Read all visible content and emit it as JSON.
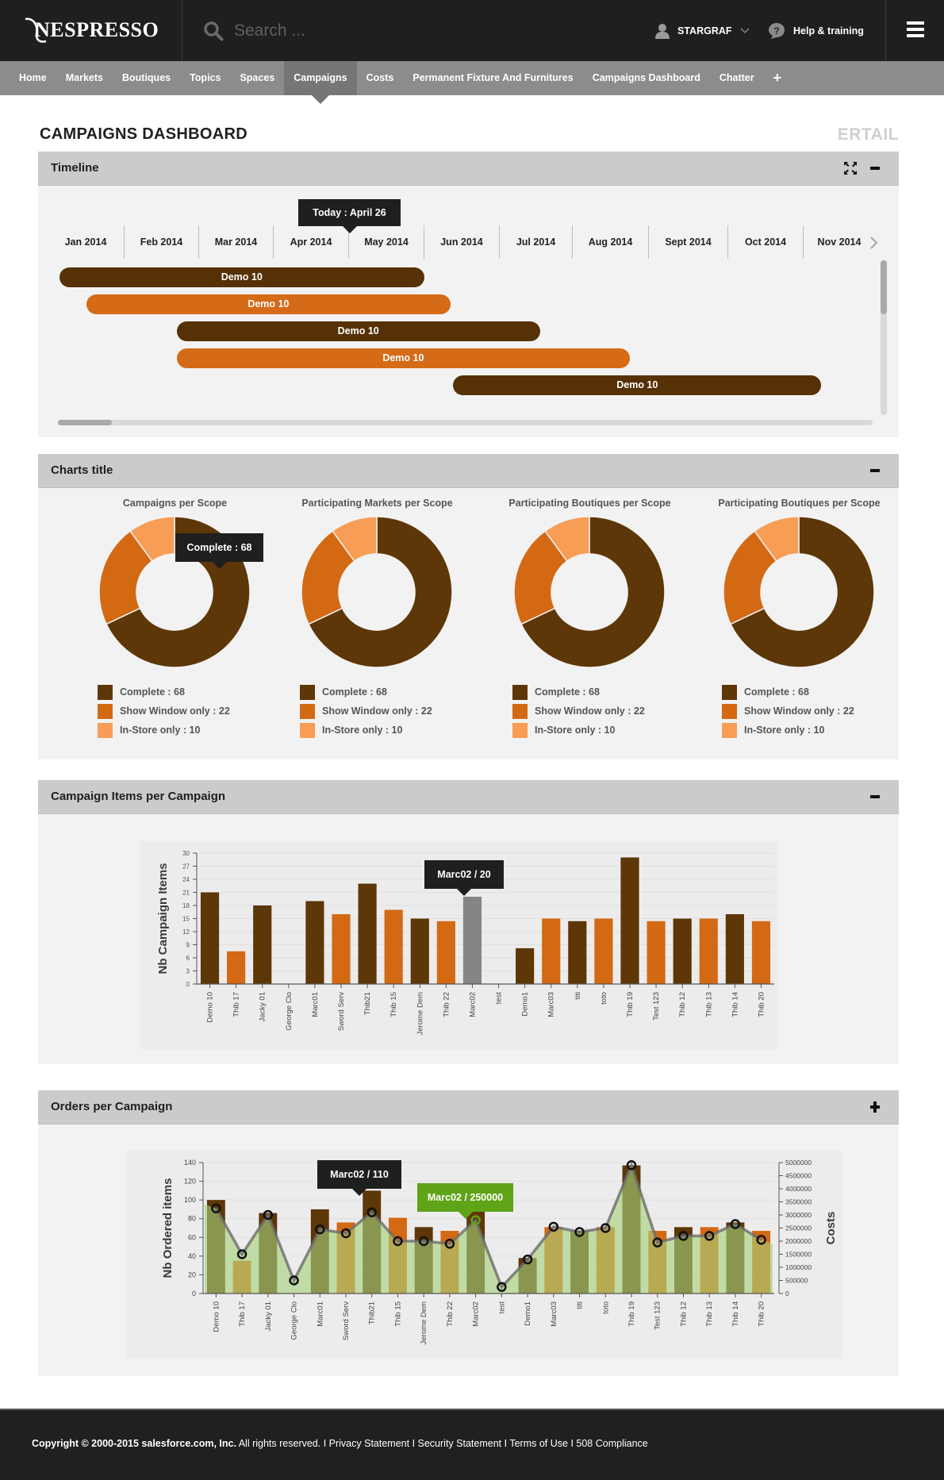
{
  "header": {
    "logo_text": "NESPRESSO",
    "search_placeholder": "Search ...",
    "user_name": "STARGRAF",
    "help_label": "Help & training"
  },
  "nav": {
    "items": [
      {
        "label": "Home",
        "active": false
      },
      {
        "label": "Markets",
        "active": false
      },
      {
        "label": "Boutiques",
        "active": false
      },
      {
        "label": "Topics",
        "active": false
      },
      {
        "label": "Spaces",
        "active": false
      },
      {
        "label": "Campaigns",
        "active": true
      },
      {
        "label": "Costs",
        "active": false
      },
      {
        "label": "Permanent Fixture And Furnitures",
        "active": false
      },
      {
        "label": "Campaigns Dashboard",
        "active": false
      },
      {
        "label": "Chatter",
        "active": false
      }
    ],
    "add_label": "+"
  },
  "page": {
    "title": "CAMPAIGNS DASHBOARD",
    "brand_right": "ERTAIL"
  },
  "timeline": {
    "title": "Timeline",
    "today_label": "Today : April 26",
    "months": [
      "Jan 2014",
      "Feb 2014",
      "Mar 2014",
      "Apr 2014",
      "May 2014",
      "Jun 2014",
      "Jul 2014",
      "Aug 2014",
      "Sept 2014",
      "Oct 2014",
      "Nov 2014"
    ],
    "bars": [
      {
        "label": "Demo 10",
        "color": "#563106",
        "start_month": 0.15,
        "end_month": 5.0
      },
      {
        "label": "Demo 10",
        "color": "#d56a17",
        "start_month": 0.5,
        "end_month": 5.35
      },
      {
        "label": "Demo 10",
        "color": "#563106",
        "start_month": 1.7,
        "end_month": 6.55
      },
      {
        "label": "Demo 10",
        "color": "#d56a17",
        "start_month": 1.7,
        "end_month": 7.75
      },
      {
        "label": "Demo 10",
        "color": "#563106",
        "start_month": 5.38,
        "end_month": 10.25
      }
    ]
  },
  "charts_panel": {
    "title": "Charts title",
    "tooltip": "Complete : 68",
    "donuts": [
      {
        "title": "Campaigns per Scope"
      },
      {
        "title": "Participating Markets per Scope"
      },
      {
        "title": "Participating Boutiques per Scope"
      },
      {
        "title": "Participating Boutiques per Scope"
      }
    ],
    "legend": [
      {
        "label": "Complete : 68",
        "color": "#5e3708"
      },
      {
        "label": "Show Window only : 22",
        "color": "#d46914"
      },
      {
        "label": "In-Store  only : 10",
        "color": "#f79d55"
      }
    ]
  },
  "items_panel": {
    "title": "Campaign Items per Campaign",
    "tooltip": "Marc02 / 20"
  },
  "orders_panel": {
    "title": "Orders per Campaign",
    "tooltip_items": "Marc02 / 110",
    "tooltip_costs": "Marc02 / 250000"
  },
  "chart_data": [
    {
      "type": "pie",
      "title": "Campaigns per Scope",
      "labels": [
        "Complete",
        "Show Window only",
        "In-Store  only"
      ],
      "values": [
        68,
        22,
        10
      ],
      "colors": [
        "#5e3708",
        "#d46914",
        "#f79d55"
      ],
      "donut": true
    },
    {
      "type": "pie",
      "title": "Participating Markets per Scope",
      "labels": [
        "Complete",
        "Show Window only",
        "In-Store  only"
      ],
      "values": [
        68,
        22,
        10
      ],
      "colors": [
        "#5e3708",
        "#d46914",
        "#f79d55"
      ],
      "donut": true
    },
    {
      "type": "pie",
      "title": "Participating Boutiques per Scope",
      "labels": [
        "Complete",
        "Show Window only",
        "In-Store  only"
      ],
      "values": [
        68,
        22,
        10
      ],
      "colors": [
        "#5e3708",
        "#d46914",
        "#f79d55"
      ],
      "donut": true
    },
    {
      "type": "pie",
      "title": "Participating Boutiques per Scope",
      "labels": [
        "Complete",
        "Show Window only",
        "In-Store  only"
      ],
      "values": [
        68,
        22,
        10
      ],
      "colors": [
        "#5e3708",
        "#d46914",
        "#f79d55"
      ],
      "donut": true
    },
    {
      "type": "bar",
      "title": "Campaign Items per Campaign",
      "xlabel": "",
      "ylabel": "Nb Campaign Items",
      "ylim": [
        0,
        30
      ],
      "yticks": [
        0,
        3,
        6,
        9,
        12,
        15,
        18,
        21,
        24,
        27,
        30
      ],
      "grid": true,
      "categories": [
        "Demo 10",
        "Thib 17",
        "Jacky 01",
        "George Clo",
        "Marc01",
        "Sword Serv",
        "Thib21",
        "Thib 15",
        "Jerome Dem",
        "Thib 22",
        "Marc02",
        "test",
        "Demo1",
        "Marc03",
        "titi",
        "toto",
        "Thib 19",
        "Test 123",
        "Thib 12",
        "Thib 13",
        "Thib 14",
        "Thib 20"
      ],
      "values": [
        21,
        7.5,
        18,
        0,
        19,
        16,
        23,
        17,
        15,
        14.4,
        20,
        0,
        8.2,
        15,
        14.4,
        15,
        29,
        14.4,
        15,
        15,
        16,
        14.4
      ],
      "colors": [
        "#5e3708",
        "#d46914",
        "#5e3708",
        "#5e3708",
        "#5e3708",
        "#d46914",
        "#5e3708",
        "#d46914",
        "#5e3708",
        "#d46914",
        "#858585",
        "#d46914",
        "#5e3708",
        "#d46914",
        "#5e3708",
        "#d46914",
        "#5e3708",
        "#d46914",
        "#5e3708",
        "#d46914",
        "#5e3708",
        "#d46914"
      ],
      "highlighted": "Marc02"
    },
    {
      "type": "bar",
      "title": "Orders per Campaign",
      "xlabel": "",
      "ylabel": "Nb Ordered items",
      "y2label": "Costs",
      "ylim": [
        0,
        140
      ],
      "yticks": [
        0,
        20,
        40,
        60,
        80,
        100,
        120,
        140
      ],
      "y2lim": [
        0,
        5000000
      ],
      "y2ticks": [
        0,
        500000,
        1000000,
        1500000,
        2000000,
        2500000,
        3000000,
        3500000,
        4000000,
        4500000,
        5000000
      ],
      "grid": true,
      "categories": [
        "Demo 10",
        "Thib 17",
        "Jacky 01",
        "George Clo",
        "Marc01",
        "Sword Serv",
        "Thib21",
        "Thib 15",
        "Jerome Dem",
        "Thib 22",
        "Marc02",
        "test",
        "Demo1",
        "Marc03",
        "titi",
        "toto",
        "Thib 19",
        "Test 123",
        "Thib 12",
        "Thib 13",
        "Thib 14",
        "Thib 20"
      ],
      "series": [
        {
          "name": "Nb Ordered items",
          "kind": "bar",
          "values": [
            100,
            35,
            86,
            0,
            90,
            76,
            110,
            81,
            71,
            67,
            88,
            0,
            38,
            71,
            67,
            71,
            137,
            67,
            71,
            71,
            76,
            67
          ],
          "colors": [
            "#5e3708",
            "#d46914",
            "#5e3708",
            "#5e3708",
            "#5e3708",
            "#d46914",
            "#5e3708",
            "#d46914",
            "#5e3708",
            "#d46914",
            "#5e3708",
            "#d46914",
            "#5e3708",
            "#d46914",
            "#5e3708",
            "#d46914",
            "#5e3708",
            "#d46914",
            "#5e3708",
            "#d46914",
            "#5e3708",
            "#d46914"
          ]
        },
        {
          "name": "Costs",
          "kind": "area-line",
          "axis": "right",
          "values": [
            3250000,
            1500000,
            3000000,
            500000,
            2450000,
            2300000,
            3100000,
            2000000,
            2000000,
            1900000,
            2800000,
            250000,
            1300000,
            2550000,
            2350000,
            2500000,
            4900000,
            1950000,
            2200000,
            2200000,
            2650000,
            2050000
          ],
          "area_color": "#a6d07a",
          "line_color": "#6b6b6b"
        }
      ],
      "highlighted": "Marc02"
    }
  ],
  "footer": {
    "copyright_bold": "Copyright © 2000-2015 salesforce.com, Inc.",
    "rights": " All rights reserved. I ",
    "links": [
      "Privacy Statement",
      "Security Statement",
      "Terms of Use",
      "508 Compliance"
    ]
  }
}
